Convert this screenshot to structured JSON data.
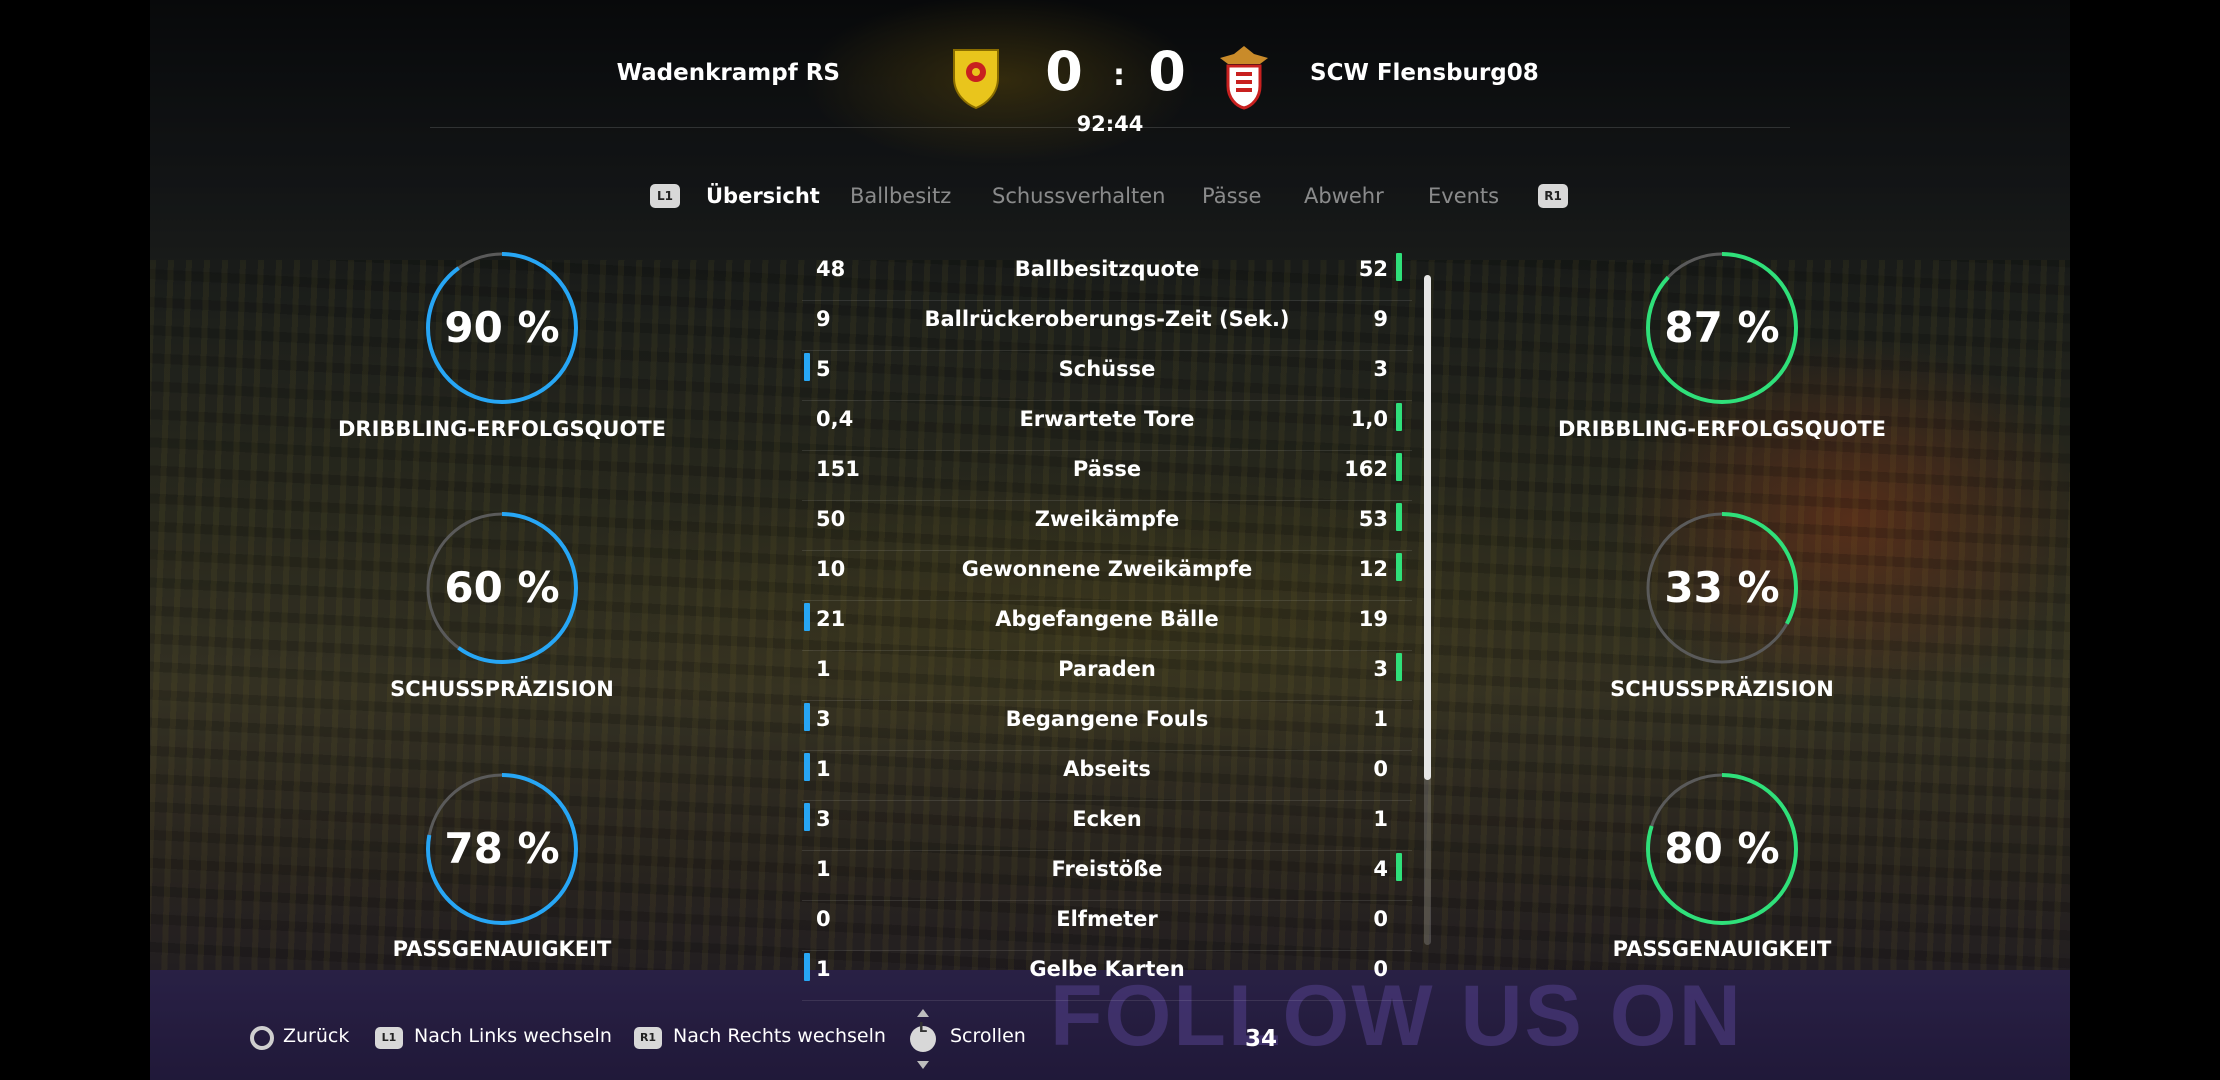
{
  "match": {
    "home_team": "Wadenkrampf RS",
    "away_team": "SCW Flensburg08",
    "home_score": "0",
    "away_score": "0",
    "separator": ":",
    "clock": "92:44"
  },
  "tabs": {
    "left_button": "L1",
    "right_button": "R1",
    "items": [
      "Übersicht",
      "Ballbesitz",
      "Schussverhalten",
      "Pässe",
      "Abwehr",
      "Events"
    ],
    "active_index": 0
  },
  "stats": [
    {
      "label": "Ballbesitzquote",
      "home": "48",
      "away": "52",
      "leader": "away"
    },
    {
      "label": "Ballrückeroberungs-Zeit (Sek.)",
      "home": "9",
      "away": "9",
      "leader": "none"
    },
    {
      "label": "Schüsse",
      "home": "5",
      "away": "3",
      "leader": "home"
    },
    {
      "label": "Erwartete Tore",
      "home": "0,4",
      "away": "1,0",
      "leader": "away"
    },
    {
      "label": "Pässe",
      "home": "151",
      "away": "162",
      "leader": "away"
    },
    {
      "label": "Zweikämpfe",
      "home": "50",
      "away": "53",
      "leader": "away"
    },
    {
      "label": "Gewonnene Zweikämpfe",
      "home": "10",
      "away": "12",
      "leader": "away"
    },
    {
      "label": "Abgefangene Bälle",
      "home": "21",
      "away": "19",
      "leader": "home"
    },
    {
      "label": "Paraden",
      "home": "1",
      "away": "3",
      "leader": "away"
    },
    {
      "label": "Begangene Fouls",
      "home": "3",
      "away": "1",
      "leader": "home"
    },
    {
      "label": "Abseits",
      "home": "1",
      "away": "0",
      "leader": "home"
    },
    {
      "label": "Ecken",
      "home": "3",
      "away": "1",
      "leader": "home"
    },
    {
      "label": "Freistöße",
      "home": "1",
      "away": "4",
      "leader": "away"
    },
    {
      "label": "Elfmeter",
      "home": "0",
      "away": "0",
      "leader": "none"
    },
    {
      "label": "Gelbe Karten",
      "home": "1",
      "away": "0",
      "leader": "home"
    }
  ],
  "rings": {
    "home": [
      {
        "value": "90 %",
        "fraction": 0.9,
        "label": "DRIBBLING-ERFOLGSQUOTE"
      },
      {
        "value": "60 %",
        "fraction": 0.6,
        "label": "SCHUSSPRÄZISION"
      },
      {
        "value": "78 %",
        "fraction": 0.78,
        "label": "PASSGENAUIGKEIT"
      }
    ],
    "away": [
      {
        "value": "87 %",
        "fraction": 0.87,
        "label": "DRIBBLING-ERFOLGSQUOTE"
      },
      {
        "value": "33 %",
        "fraction": 0.33,
        "label": "SCHUSSPRÄZISION"
      },
      {
        "value": "80 %",
        "fraction": 0.8,
        "label": "PASSGENAUIGKEIT"
      }
    ]
  },
  "colors": {
    "home_accent": "#27a6f5",
    "away_accent": "#2fe07a",
    "ring_track": "#5a5a5a"
  },
  "footer": {
    "back": "Zurück",
    "left_button": "L1",
    "left_label": "Nach Links wechseln",
    "right_button": "R1",
    "right_label": "Nach Rechts wechseln",
    "scroll_button": "L",
    "scroll_label": "Scrollen",
    "count": "34"
  },
  "background": {
    "board_text": "FOLLOW US ON"
  }
}
